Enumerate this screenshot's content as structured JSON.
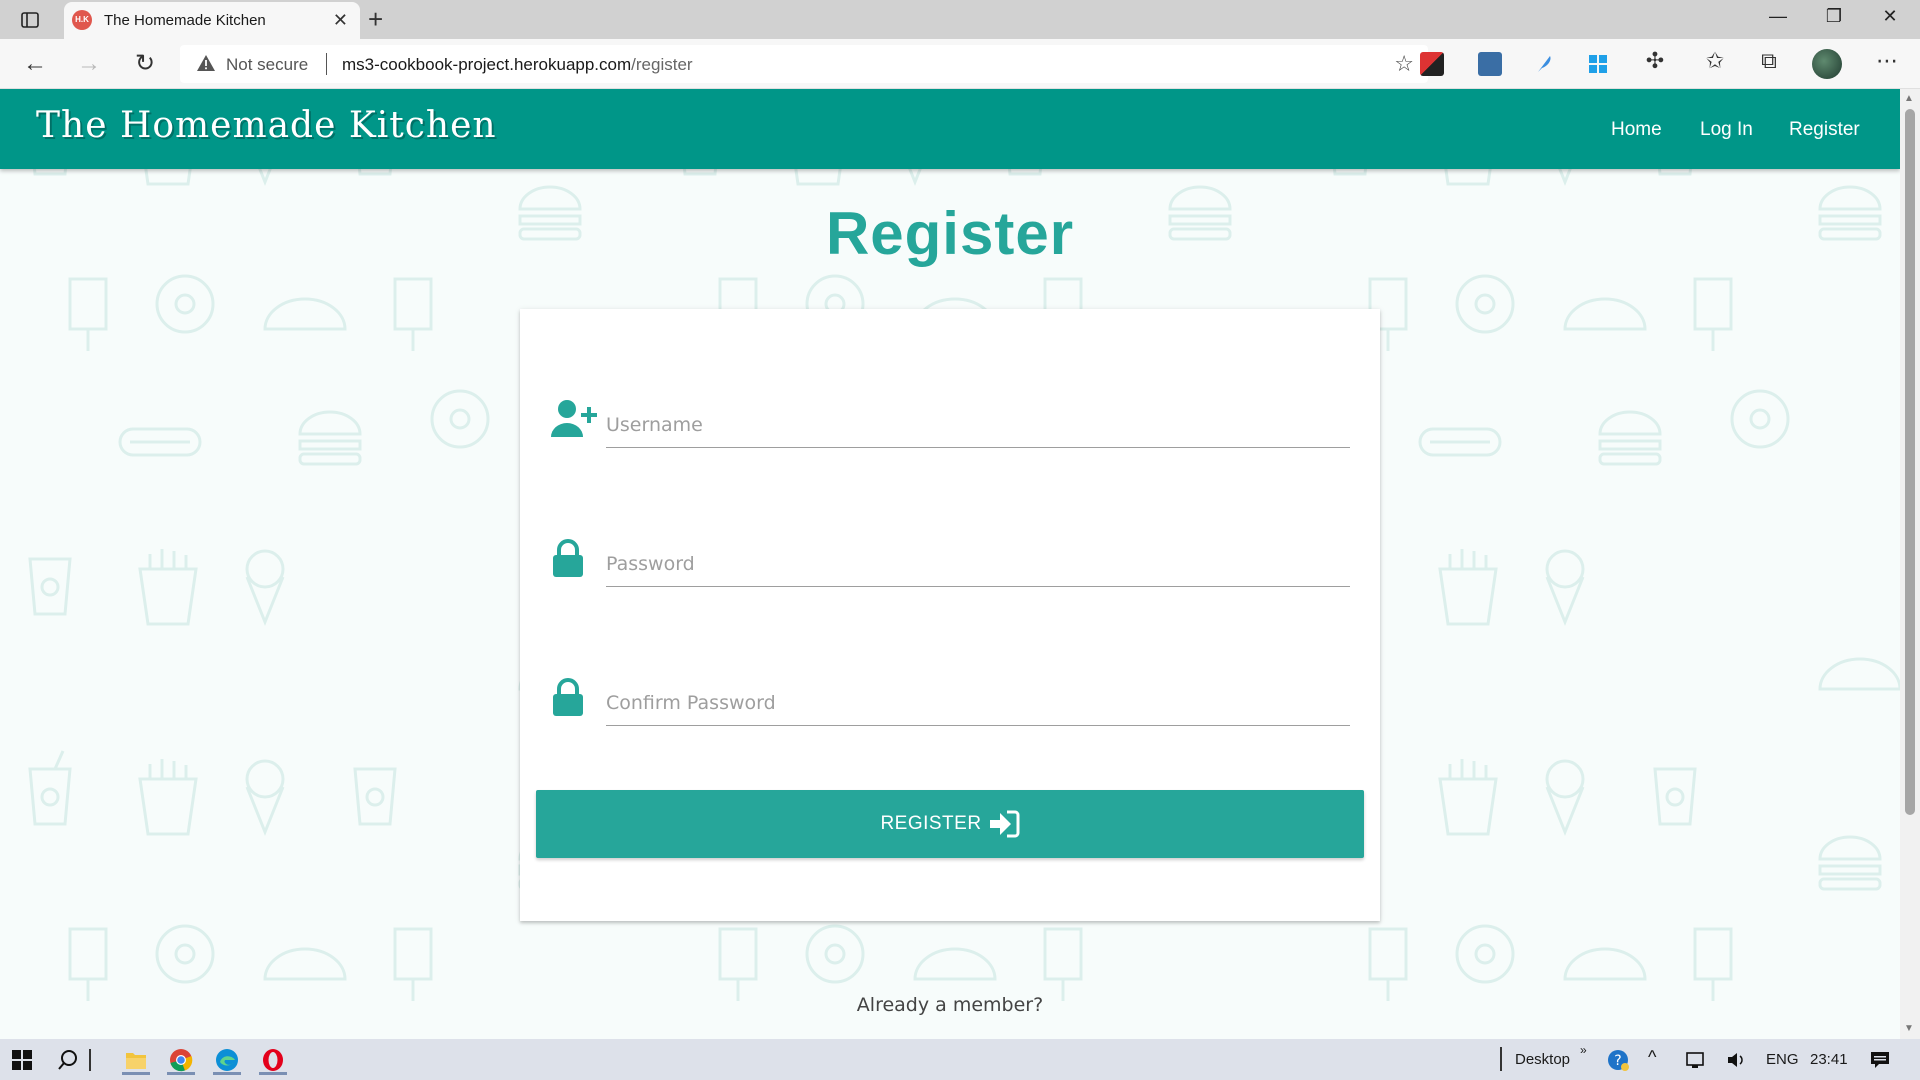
{
  "browser": {
    "tab_title": "The Homemade Kitchen",
    "tab_favicon_text": "H.K",
    "security_label": "Not secure",
    "url_host": "ms3-cookbook-project.herokuapp.com",
    "url_path": "/register"
  },
  "site": {
    "brand": "The Homemade Kitchen",
    "nav": {
      "home": "Home",
      "login": "Log In",
      "register": "Register"
    },
    "accent_color": "#009688",
    "button_color": "#26a69a"
  },
  "form": {
    "title": "Register",
    "username_placeholder": "Username",
    "password_placeholder": "Password",
    "confirm_placeholder": "Confirm Password",
    "submit_label": "REGISTER"
  },
  "footer_text": "Already a member?",
  "taskbar": {
    "desktop_label": "Desktop",
    "language": "ENG",
    "time": "23:41"
  }
}
